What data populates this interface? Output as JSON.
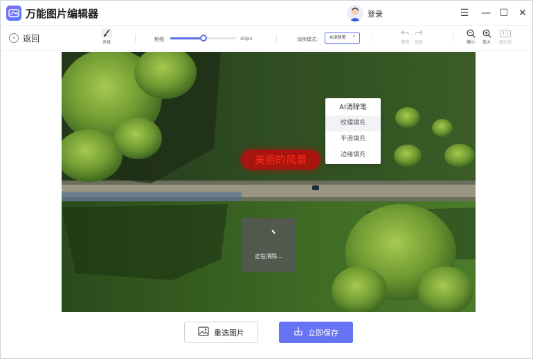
{
  "app": {
    "title": "万能图片编辑器",
    "login": "登录"
  },
  "window_controls": {
    "menu": "☰",
    "minimize": "—",
    "maximize": "☐",
    "close": "✕"
  },
  "toolbar": {
    "back_label": "返回",
    "brush_label": "涂抹",
    "size_label": "粗细",
    "size_value": 40,
    "size_unit": "40px",
    "mode_label": "消除模式:",
    "mode_selected": "AI消除笔",
    "undo_label": "撤销",
    "redo_label": "恢复",
    "zoom_out_label": "缩小",
    "zoom_in_label": "放大",
    "original_ratio_badge": "1:1",
    "original_ratio_label": "原比例"
  },
  "mode_dropdown": {
    "options": [
      "AI消除笔",
      "纹理填充",
      "平滑填充",
      "边缘填充"
    ]
  },
  "canvas": {
    "overlay_text": "美丽的风景",
    "progress_message": "正在消除..."
  },
  "actions": {
    "reselect_label": "重选图片",
    "save_label": "立即保存"
  },
  "colors": {
    "accent": "#5b6cf0",
    "save_button": "#6673f3",
    "overlay_text": "#ff2a1a"
  }
}
